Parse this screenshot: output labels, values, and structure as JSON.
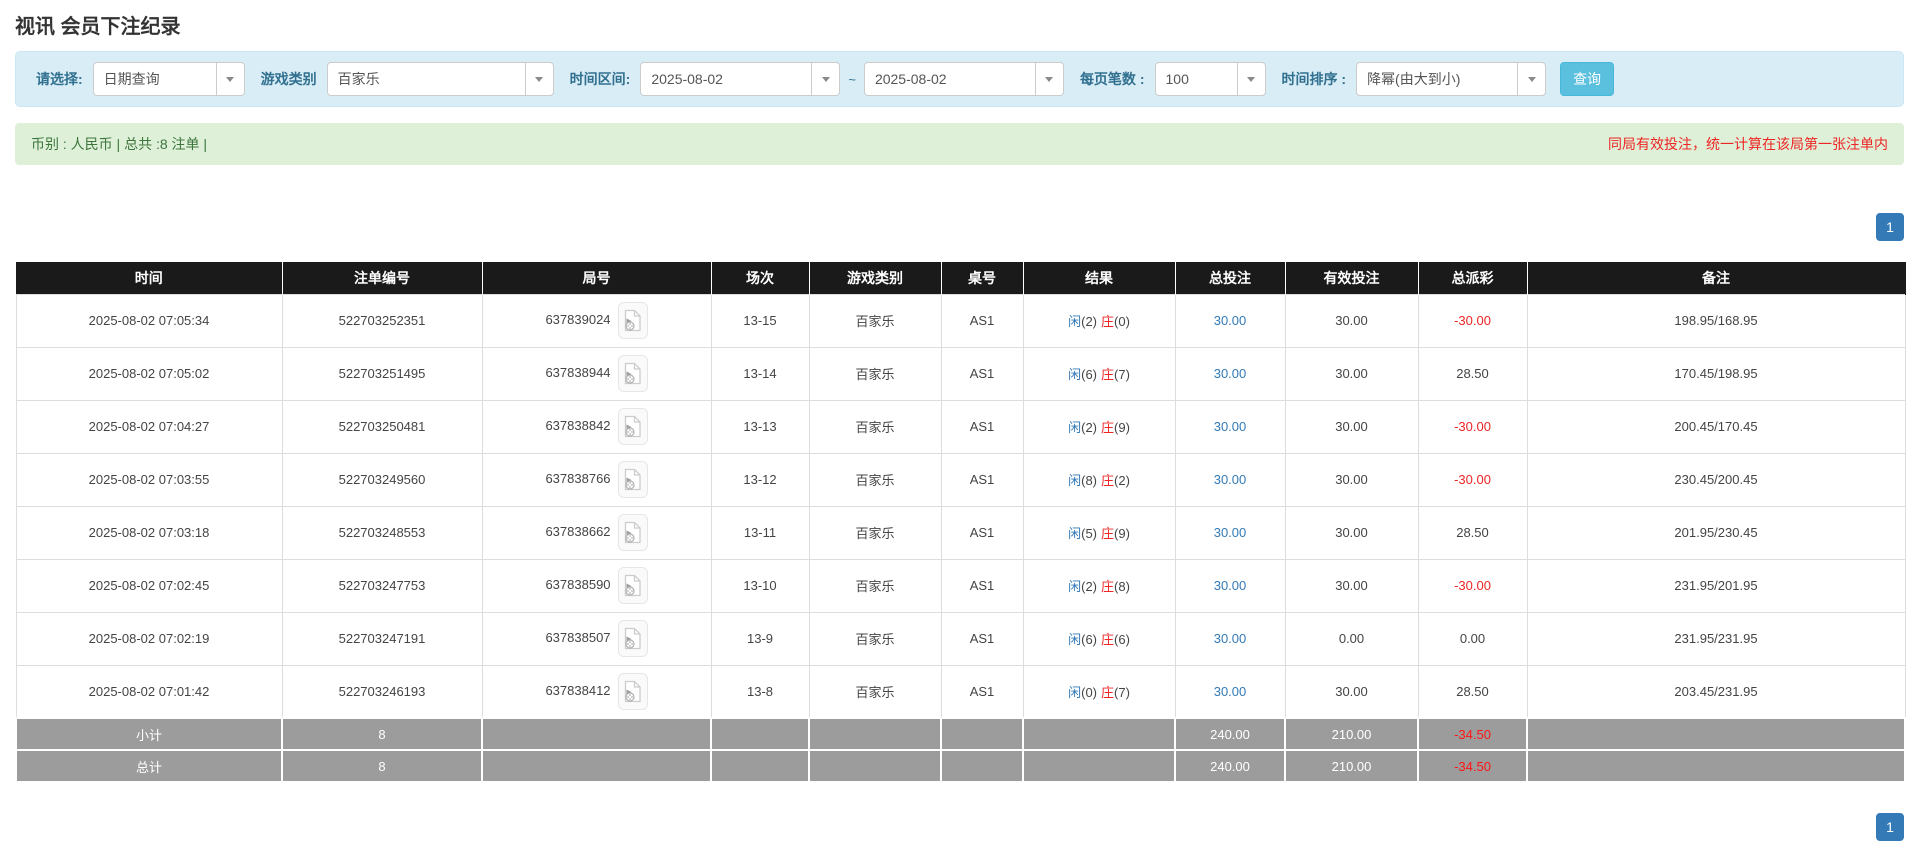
{
  "page": {
    "title": "视讯 会员下注纪录"
  },
  "colors": {
    "accent_blue": "#337ab7",
    "search_button_bg": "#5bc0de",
    "filter_bar_bg": "#d9edf7",
    "summary_bar_bg": "#dff0d8",
    "summary_green": "#3c763d",
    "notice_red": "#ee2525",
    "table_header_bg": "#1a1a1a",
    "table_footer_bg": "#9c9c9c"
  },
  "filters": {
    "select_type": {
      "label": "请选择:",
      "value": "日期查询"
    },
    "game_category": {
      "label": "游戏类别",
      "value": "百家乐"
    },
    "time_range": {
      "label": "时间区间:",
      "from": "2025-08-02",
      "separator": "~",
      "to": "2025-08-02"
    },
    "page_size": {
      "label": "每页笔数 :",
      "value": "100"
    },
    "time_sort": {
      "label": "时间排序 :",
      "value": "降幂(由大到小)"
    },
    "search_button": "查询"
  },
  "summary": {
    "left": "币别 : 人民币 | 总共 :8 注单 |",
    "right_notice": "同局有效投注，统一计算在该局第一张注单内"
  },
  "pagination": {
    "top": "1",
    "bottom": "1"
  },
  "table": {
    "columns": [
      "时间",
      "注单编号",
      "局号",
      "场次",
      "游戏类别",
      "桌号",
      "结果",
      "总投注",
      "有效投注",
      "总派彩",
      "备注"
    ],
    "rows": [
      {
        "time": "2025-08-02 07:05:34",
        "bet_id": "522703252351",
        "round_id": "637839024",
        "session": "13-15",
        "game_type": "百家乐",
        "table_no": "AS1",
        "player_label": "闲",
        "player_num": "(2)",
        "banker_label": "庄",
        "banker_num": "(0)",
        "total_bet": "30.00",
        "valid_bet": "30.00",
        "payout": "-30.00",
        "remark": "198.95/168.95"
      },
      {
        "time": "2025-08-02 07:05:02",
        "bet_id": "522703251495",
        "round_id": "637838944",
        "session": "13-14",
        "game_type": "百家乐",
        "table_no": "AS1",
        "player_label": "闲",
        "player_num": "(6)",
        "banker_label": "庄",
        "banker_num": "(7)",
        "total_bet": "30.00",
        "valid_bet": "30.00",
        "payout": "28.50",
        "remark": "170.45/198.95"
      },
      {
        "time": "2025-08-02 07:04:27",
        "bet_id": "522703250481",
        "round_id": "637838842",
        "session": "13-13",
        "game_type": "百家乐",
        "table_no": "AS1",
        "player_label": "闲",
        "player_num": "(2)",
        "banker_label": "庄",
        "banker_num": "(9)",
        "total_bet": "30.00",
        "valid_bet": "30.00",
        "payout": "-30.00",
        "remark": "200.45/170.45"
      },
      {
        "time": "2025-08-02 07:03:55",
        "bet_id": "522703249560",
        "round_id": "637838766",
        "session": "13-12",
        "game_type": "百家乐",
        "table_no": "AS1",
        "player_label": "闲",
        "player_num": "(8)",
        "banker_label": "庄",
        "banker_num": "(2)",
        "total_bet": "30.00",
        "valid_bet": "30.00",
        "payout": "-30.00",
        "remark": "230.45/200.45"
      },
      {
        "time": "2025-08-02 07:03:18",
        "bet_id": "522703248553",
        "round_id": "637838662",
        "session": "13-11",
        "game_type": "百家乐",
        "table_no": "AS1",
        "player_label": "闲",
        "player_num": "(5)",
        "banker_label": "庄",
        "banker_num": "(9)",
        "total_bet": "30.00",
        "valid_bet": "30.00",
        "payout": "28.50",
        "remark": "201.95/230.45"
      },
      {
        "time": "2025-08-02 07:02:45",
        "bet_id": "522703247753",
        "round_id": "637838590",
        "session": "13-10",
        "game_type": "百家乐",
        "table_no": "AS1",
        "player_label": "闲",
        "player_num": "(2)",
        "banker_label": "庄",
        "banker_num": "(8)",
        "total_bet": "30.00",
        "valid_bet": "30.00",
        "payout": "-30.00",
        "remark": "231.95/201.95"
      },
      {
        "time": "2025-08-02 07:02:19",
        "bet_id": "522703247191",
        "round_id": "637838507",
        "session": "13-9",
        "game_type": "百家乐",
        "table_no": "AS1",
        "player_label": "闲",
        "player_num": "(6)",
        "banker_label": "庄",
        "banker_num": "(6)",
        "total_bet": "30.00",
        "valid_bet": "0.00",
        "payout": "0.00",
        "remark": "231.95/231.95"
      },
      {
        "time": "2025-08-02 07:01:42",
        "bet_id": "522703246193",
        "round_id": "637838412",
        "session": "13-8",
        "game_type": "百家乐",
        "table_no": "AS1",
        "player_label": "闲",
        "player_num": "(0)",
        "banker_label": "庄",
        "banker_num": "(7)",
        "total_bet": "30.00",
        "valid_bet": "30.00",
        "payout": "28.50",
        "remark": "203.45/231.95"
      }
    ],
    "footer": [
      {
        "label": "小计",
        "count": "8",
        "total_bet": "240.00",
        "valid_bet": "210.00",
        "payout": "-34.50"
      },
      {
        "label": "总计",
        "count": "8",
        "total_bet": "240.00",
        "valid_bet": "210.00",
        "payout": "-34.50"
      }
    ]
  }
}
